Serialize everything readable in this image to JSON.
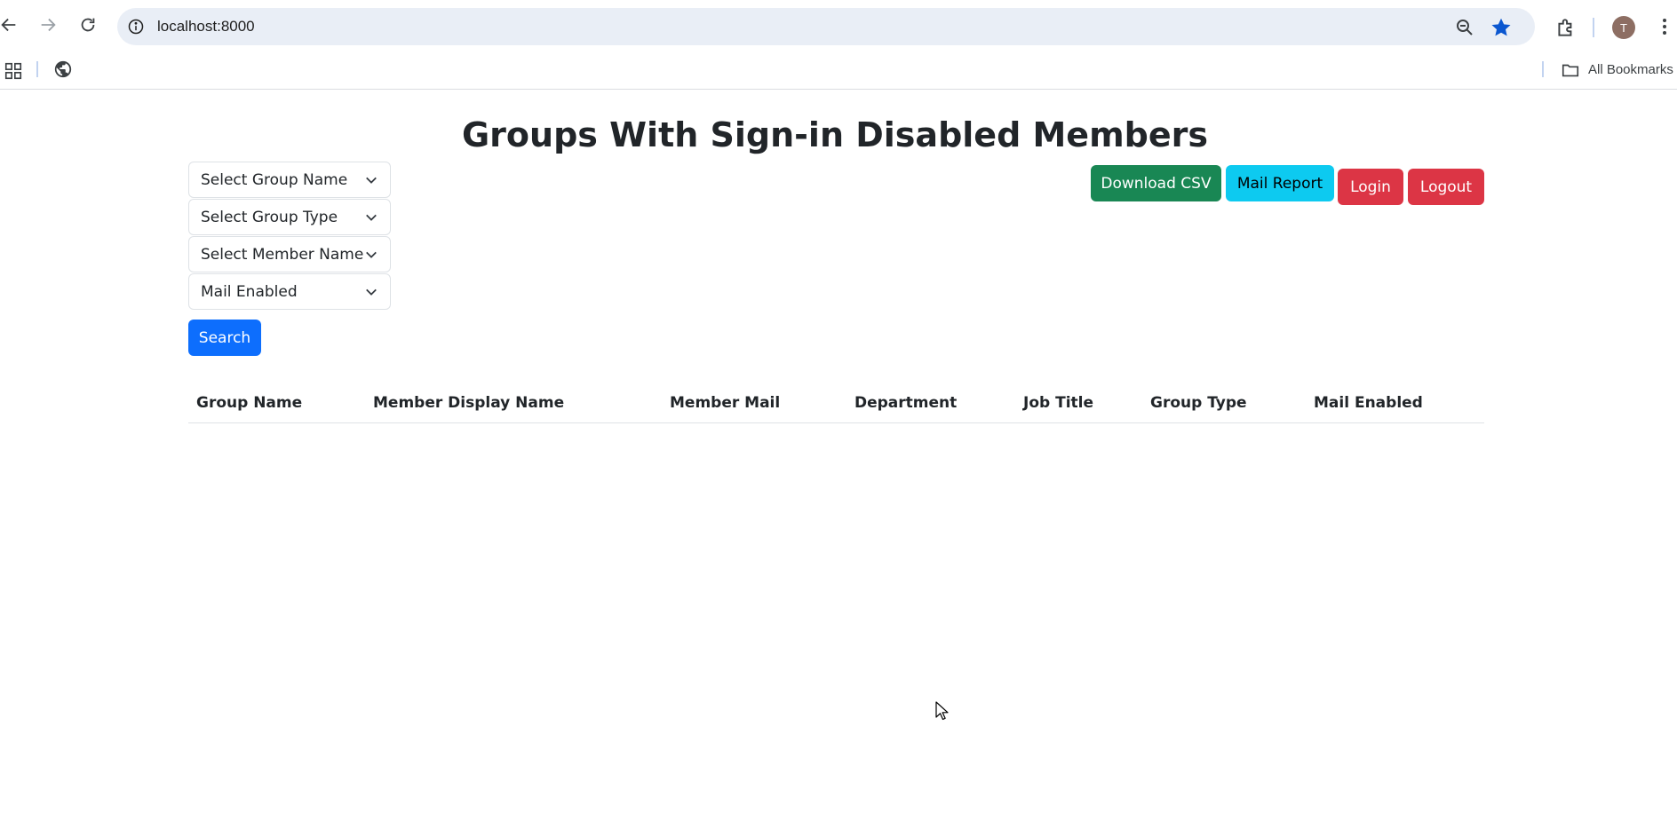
{
  "browser": {
    "url": "localhost:8000",
    "profile_initial": "T",
    "bookmarks_label": "All Bookmarks"
  },
  "page": {
    "title": "Groups With Sign-in Disabled Members"
  },
  "filters": {
    "group_name": "Select Group Name",
    "group_type": "Select Group Type",
    "member_name": "Select Member Name",
    "mail_enabled": "Mail Enabled",
    "search_label": "Search"
  },
  "actions": {
    "download_csv": "Download CSV",
    "mail_report": "Mail Report",
    "login": "Login",
    "logout": "Logout"
  },
  "table": {
    "columns": [
      "Group Name",
      "Member Display Name",
      "Member Mail",
      "Department",
      "Job Title",
      "Group Type",
      "Mail Enabled"
    ],
    "rows": []
  },
  "colors": {
    "primary": "#0d6efd",
    "success": "#198754",
    "info": "#0dcaf0",
    "danger": "#dc3545",
    "star": "#0b57d0"
  }
}
